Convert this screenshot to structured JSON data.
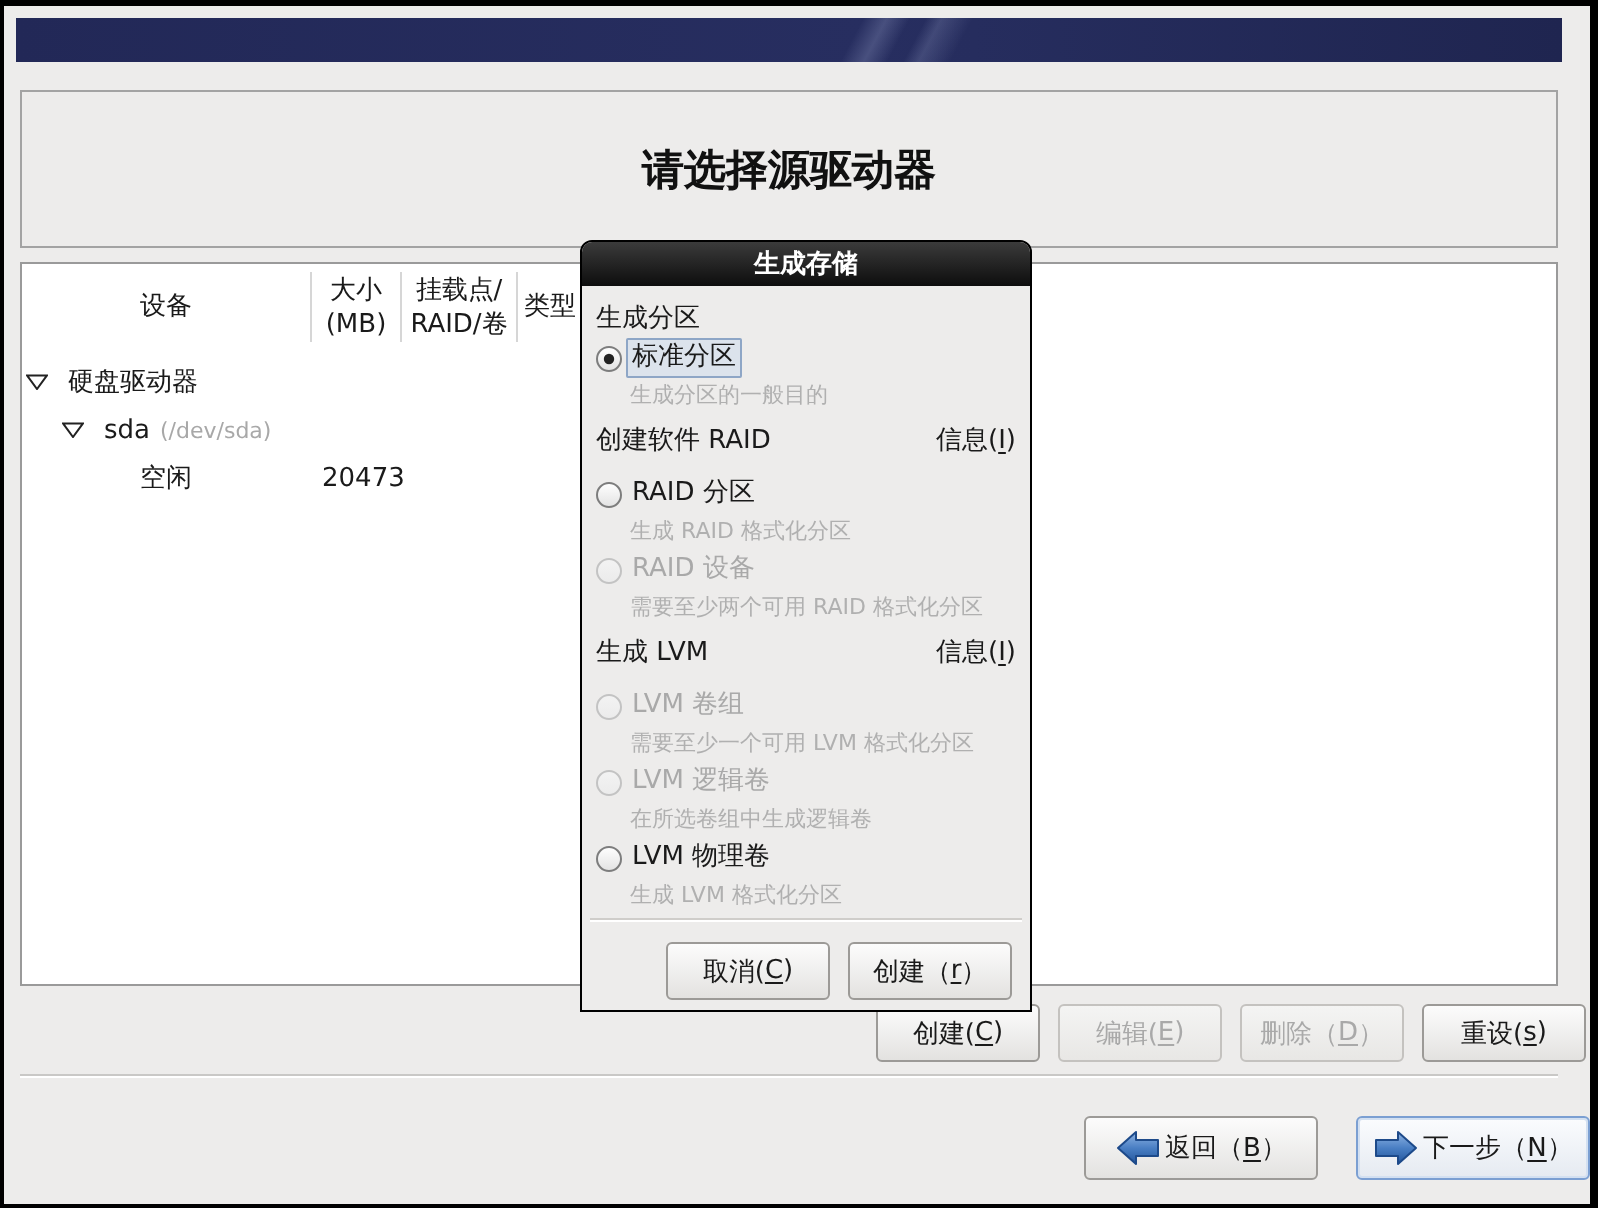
{
  "header": {
    "title": "请选择源驱动器"
  },
  "table": {
    "columns": [
      {
        "lines": [
          "设备"
        ]
      },
      {
        "lines": [
          "大小",
          "(MB)"
        ]
      },
      {
        "lines": [
          "挂载点/",
          "RAID/卷"
        ]
      },
      {
        "lines": [
          "类型"
        ]
      }
    ],
    "rows": [
      {
        "device": "硬盘驱动器",
        "expanded": true,
        "children": [
          {
            "device": "sda",
            "path": "(/dev/sda)",
            "expanded": true,
            "children": [
              {
                "device": "空闲",
                "size": "20473"
              }
            ]
          }
        ]
      }
    ]
  },
  "actions": [
    {
      "text": "创建(",
      "key": "C",
      "tail": ")",
      "disabled": false
    },
    {
      "text": "编辑(",
      "key": "E",
      "tail": ")",
      "disabled": true
    },
    {
      "text": "删除（",
      "key": "D",
      "tail": "）",
      "disabled": true
    },
    {
      "text": "重设(",
      "key": "s",
      "tail": ")",
      "disabled": false
    }
  ],
  "navigation": [
    {
      "kind": "back",
      "text": "返回（",
      "key": "B",
      "tail": "）",
      "focused": false
    },
    {
      "kind": "next",
      "text": "下一步（",
      "key": "N",
      "tail": "）",
      "focused": true
    }
  ],
  "dialog": {
    "title": "生成存储",
    "sections": [
      {
        "heading": "生成分区",
        "options": [
          {
            "label": "标准分区",
            "description": "生成分区的一般目的",
            "selected": true,
            "disabled": false,
            "focused": true
          }
        ]
      },
      {
        "heading": "创建软件 RAID",
        "info": {
          "text": "信息(",
          "key": "I",
          "tail": ")"
        },
        "options": [
          {
            "label": "RAID 分区",
            "description": "生成 RAID 格式化分区",
            "selected": false,
            "disabled": false,
            "focused": false
          },
          {
            "label": "RAID 设备",
            "description": "需要至少两个可用 RAID 格式化分区",
            "selected": false,
            "disabled": true,
            "focused": false
          }
        ]
      },
      {
        "heading": "生成 LVM",
        "info": {
          "text": "信息(",
          "key": "I",
          "tail": ")"
        },
        "options": [
          {
            "label": "LVM 卷组",
            "description": "需要至少一个可用 LVM 格式化分区",
            "selected": false,
            "disabled": true,
            "focused": false
          },
          {
            "label": "LVM 逻辑卷",
            "description": "在所选卷组中生成逻辑卷",
            "selected": false,
            "disabled": true,
            "focused": false
          },
          {
            "label": "LVM 物理卷",
            "description": "生成 LVM 格式化分区",
            "selected": false,
            "disabled": false,
            "focused": false
          }
        ]
      }
    ],
    "buttons": [
      {
        "text": "取消(",
        "key": "C",
        "tail": ")"
      },
      {
        "text": "创建（",
        "key": "r",
        "tail": "）"
      }
    ]
  }
}
